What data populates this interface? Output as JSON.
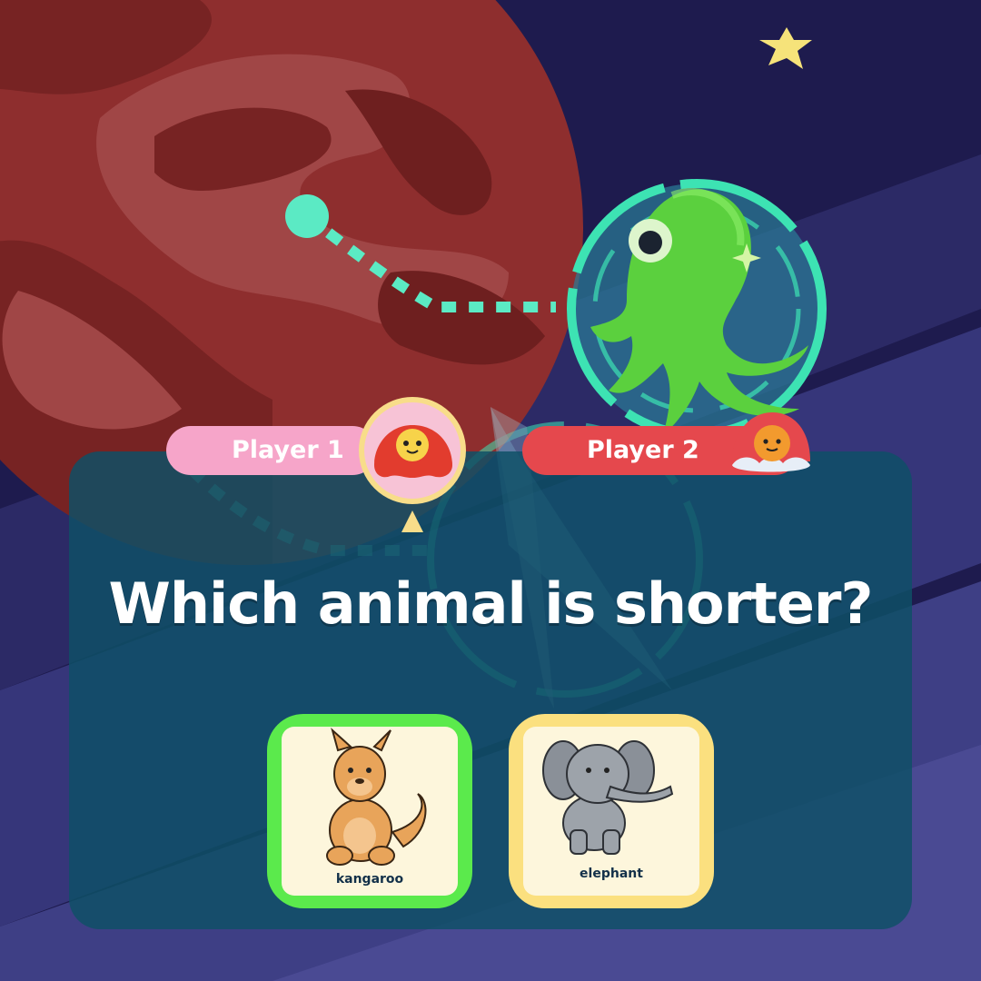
{
  "players": [
    {
      "label": "Player 1",
      "avatar": "red-blob-avatar-icon",
      "color": "#F6A5C9"
    },
    {
      "label": "Player 2",
      "avatar": "orange-blob-avatar-icon",
      "color": "#E5484D"
    }
  ],
  "question": "Which animal is shorter?",
  "answers": [
    {
      "label": "kangaroo",
      "icon": "kangaroo-icon",
      "selected": true,
      "border_color": "#5BEA4C"
    },
    {
      "label": "elephant",
      "icon": "elephant-icon",
      "selected": false,
      "border_color": "#FBE07F"
    }
  ],
  "scene": {
    "planet": "red-planet",
    "creature": "green-octopus-alien",
    "star": "yellow-star",
    "colors": {
      "sky": "#1E1B4E",
      "path": "#5BEAC4",
      "planet": "#8E2E2E"
    }
  }
}
